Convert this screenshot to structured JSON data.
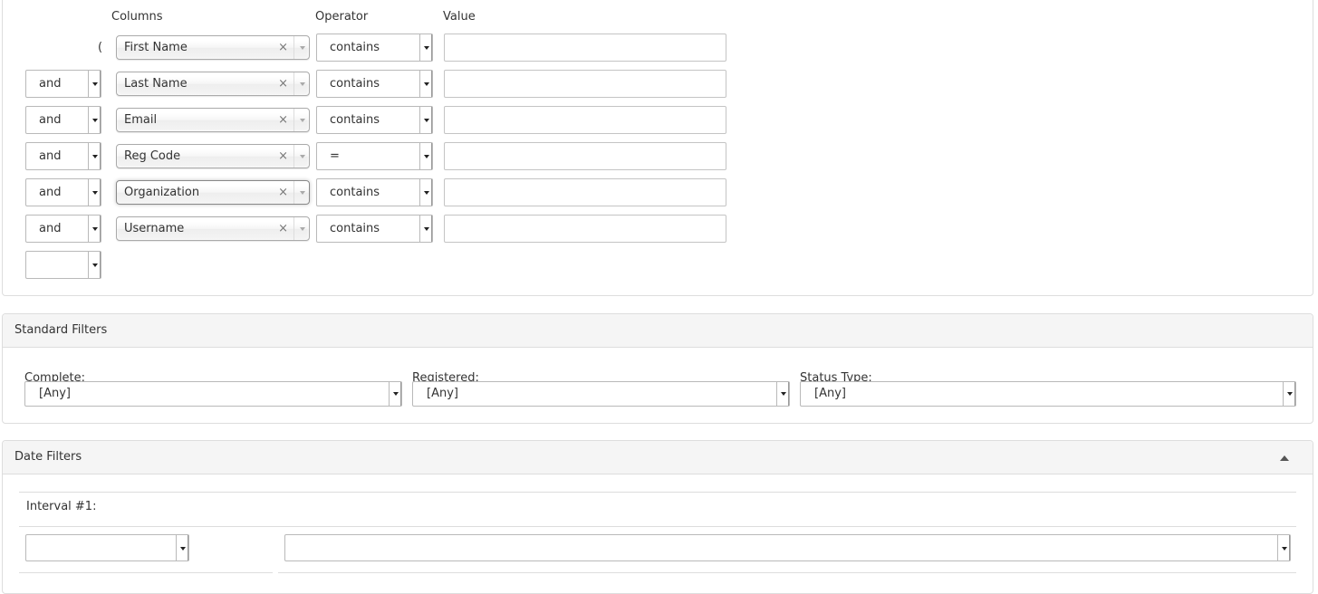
{
  "search": {
    "headers": {
      "columns": "Columns",
      "operator": "Operator",
      "value": "Value"
    },
    "open_paren": "(",
    "rows": [
      {
        "conj": "",
        "column": "First Name",
        "operator": "contains",
        "value": ""
      },
      {
        "conj": "and",
        "column": "Last Name",
        "operator": "contains",
        "value": ""
      },
      {
        "conj": "and",
        "column": "Email",
        "operator": "contains",
        "value": ""
      },
      {
        "conj": "and",
        "column": "Reg Code",
        "operator": "=",
        "value": ""
      },
      {
        "conj": "and",
        "column": "Organization",
        "operator": "contains",
        "value": ""
      },
      {
        "conj": "and",
        "column": "Username",
        "operator": "contains",
        "value": ""
      }
    ],
    "clear_glyph": "×",
    "extra_conj": ""
  },
  "standard_filters": {
    "title": "Standard Filters",
    "complete": {
      "label": "Complete:",
      "value": "[Any]"
    },
    "registered": {
      "label": "Registered:",
      "value": "[Any]"
    },
    "status_type": {
      "label": "Status Type:",
      "value": "[Any]"
    }
  },
  "date_filters": {
    "title": "Date Filters",
    "interval_label": "Interval #1:",
    "interval_type": "",
    "interval_value": ""
  },
  "icons": {
    "collapse": "triangle-up-icon",
    "dropdown": "triangle-down-icon",
    "clear": "x-icon"
  }
}
